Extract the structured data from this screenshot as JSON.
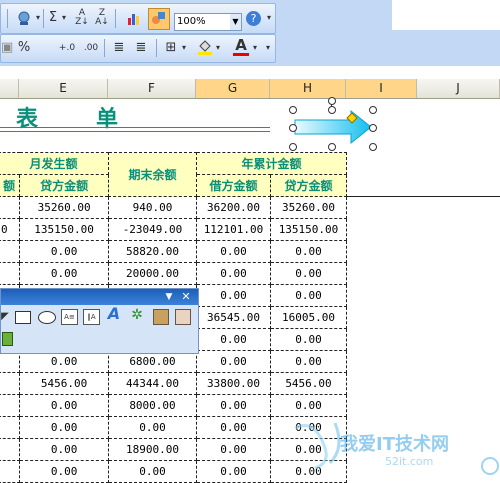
{
  "toolbar": {
    "zoom": "100%",
    "icons_row1": [
      "research-icon",
      "sum-icon",
      "sort-ascending-icon",
      "sort-descending-icon",
      "chart-wizard-icon",
      "drawing-icon",
      "help-icon"
    ],
    "icons_row2": [
      "percent-style-icon",
      "increase-decimal-icon",
      "decrease-decimal-icon",
      "decrease-indent-icon",
      "increase-indent-icon",
      "borders-icon",
      "fill-color-icon",
      "font-color-icon"
    ],
    "percent_glyph": "%",
    "inc_decimal": "+.0",
    "dec_decimal": ".00",
    "sum_glyph": "Σ",
    "font_color_glyph": "A",
    "help_glyph": "?"
  },
  "columns": {
    "E": "E",
    "F": "F",
    "G": "G",
    "H": "H",
    "I": "I",
    "J": "J"
  },
  "sheet": {
    "title_char1": "表",
    "title_char2": "单",
    "header_month": "月发生额",
    "header_closing": "期末余额",
    "header_ytd": "年累计金额",
    "sub_debit_partial": "额",
    "sub_credit": "贷方金额",
    "sub_debit": "借方金额",
    "sub_credit2": "贷方金额",
    "rows": [
      [
        "",
        "35260.00",
        "940.00",
        "36200.00",
        "35260.00"
      ],
      [
        "0",
        "135150.00",
        "-23049.00",
        "112101.00",
        "135150.00"
      ],
      [
        "",
        "0.00",
        "58820.00",
        "0.00",
        "0.00"
      ],
      [
        "",
        "0.00",
        "20000.00",
        "0.00",
        "0.00"
      ],
      [
        "",
        "",
        "",
        "0.00",
        "0.00"
      ],
      [
        "",
        "",
        "",
        "36545.00",
        "16005.00"
      ],
      [
        "",
        "",
        "",
        "0.00",
        "0.00"
      ],
      [
        "",
        "0.00",
        "6800.00",
        "0.00",
        "0.00"
      ],
      [
        "",
        "5456.00",
        "44344.00",
        "33800.00",
        "5456.00"
      ],
      [
        "",
        "0.00",
        "8000.00",
        "0.00",
        "0.00"
      ],
      [
        "",
        "0.00",
        "0.00",
        "0.00",
        "0.00"
      ],
      [
        "",
        "0.00",
        "18900.00",
        "0.00",
        "0.00"
      ],
      [
        "",
        "0.00",
        "0.00",
        "0.00",
        "0.00"
      ]
    ]
  },
  "drawing_toolbar": {
    "dropdown_glyph": "▼",
    "close_glyph": "✕",
    "icons": [
      "rectangle-icon",
      "oval-icon",
      "textbox-icon",
      "vertical-textbox-icon",
      "wordart-icon",
      "diagram-icon",
      "clipart-icon",
      "picture-icon",
      "3d-icon"
    ]
  },
  "watermark": {
    "text": "我爱IT技术网",
    "url": "52it.com"
  },
  "colors": {
    "accent_teal": "#0a8f7a",
    "header_fill": "#ffffc0",
    "arrow_cyan": "#23c7ee",
    "toolbar_blue": "#c6dbf7"
  }
}
